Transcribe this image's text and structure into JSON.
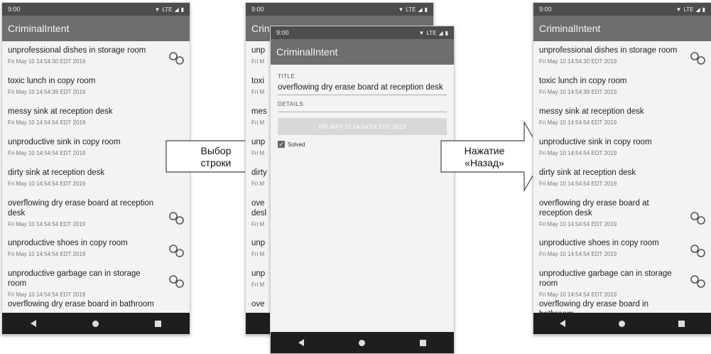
{
  "status": {
    "time": "9:00",
    "network": "LTE"
  },
  "app": {
    "title": "CriminalIntent"
  },
  "crimes": [
    {
      "title": "unprofessional dishes in storage room",
      "date": "Fri May 10 14:54:30 EDT 2019",
      "solved": true
    },
    {
      "title": "toxic lunch in copy room",
      "date": "Fri May 10 14:54:39 EDT 2019",
      "solved": false
    },
    {
      "title": "messy sink at reception desk",
      "date": "Fri May 10 14:54:54 EDT 2019",
      "solved": false
    },
    {
      "title": "unproductive sink in copy room",
      "date": "Fri May 10 14:54:54 EDT 2019",
      "solved": false
    },
    {
      "title": "dirty sink at reception desk",
      "date": "Fri May 10 14:54:54 EDT 2019",
      "solved": false
    },
    {
      "title": "overflowing dry erase board at reception desk",
      "date": "Fri May 10 14:54:54 EDT 2019",
      "solved": true
    },
    {
      "title": "unproductive shoes in copy room",
      "date": "Fri May 10 14:54:54 EDT 2019",
      "solved": true
    },
    {
      "title": "unproductive garbage can in storage room",
      "date": "Fri May 10 14:54:54 EDT 2019",
      "solved": true
    },
    {
      "title": "overflowing dry erase board in bathroom",
      "date": "",
      "solved": false
    }
  ],
  "detail": {
    "title_label": "TITLE",
    "title_value": "overflowing dry erase board at reception desk",
    "details_label": "DETAILS",
    "date_button": "FRI MAY 10 14:54:54 EDT 2019",
    "solved_label": "Solved",
    "solved_checked": true
  },
  "behind": {
    "title_fragment": "Crin",
    "row_fragments": [
      "unp",
      "toxi",
      "mes",
      "unp",
      "dirty",
      "ove",
      "unp",
      "unp",
      "ove"
    ],
    "date_fragment": "Fri M",
    "tall_extra": "desl"
  },
  "arrows": {
    "select_row": "Выбор\nстроки",
    "press_back": "Нажатие\n«Назад»"
  }
}
